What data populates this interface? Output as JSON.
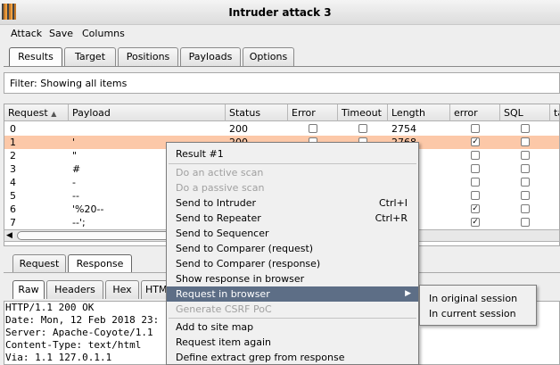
{
  "window": {
    "title": "Intruder attack 3"
  },
  "menubar": [
    "Attack",
    "Save",
    "Columns"
  ],
  "main_tabs": [
    "Results",
    "Target",
    "Positions",
    "Payloads",
    "Options"
  ],
  "filter": {
    "text": "Filter: Showing all items"
  },
  "table": {
    "sort_arrow": "▲",
    "headers": [
      "Request",
      "Payload",
      "Status",
      "Error",
      "Timeout",
      "Length",
      "error",
      "SQL",
      "ta"
    ],
    "rows": [
      {
        "request": "0",
        "payload": "",
        "status": "200",
        "length": "2754",
        "error": false,
        "timeout": false,
        "error_col": false,
        "sql": false
      },
      {
        "request": "1",
        "payload": "'",
        "status": "200",
        "length": "2768",
        "error": false,
        "timeout": false,
        "error_col": true,
        "sql": false
      },
      {
        "request": "2",
        "payload": "\"",
        "status": "",
        "length": "",
        "error": false,
        "timeout": false,
        "error_col": false,
        "sql": false
      },
      {
        "request": "3",
        "payload": "#",
        "status": "",
        "length": "",
        "error": false,
        "timeout": false,
        "error_col": false,
        "sql": false
      },
      {
        "request": "4",
        "payload": "-",
        "status": "",
        "length": "",
        "error": false,
        "timeout": false,
        "error_col": false,
        "sql": false
      },
      {
        "request": "5",
        "payload": "--",
        "status": "",
        "length": "",
        "error": false,
        "timeout": false,
        "error_col": false,
        "sql": false
      },
      {
        "request": "6",
        "payload": "'%20--",
        "status": "",
        "length": "",
        "error": false,
        "timeout": false,
        "error_col": true,
        "sql": false
      },
      {
        "request": "7",
        "payload": "--';",
        "status": "",
        "length": "",
        "error": false,
        "timeout": false,
        "error_col": true,
        "sql": false
      }
    ],
    "check_mark": "✓",
    "scroll_left": "◀"
  },
  "panel_tabs": [
    "Request",
    "Response"
  ],
  "response_tabs": [
    "Raw",
    "Headers",
    "Hex",
    "HTM"
  ],
  "response_lines": [
    "HTTP/1.1 200 OK",
    "Date: Mon, 12 Feb 2018 23:",
    "Server: Apache-Coyote/1.1",
    "Content-Type: text/html",
    "Via: 1.1 127.0.1.1"
  ],
  "context_menu": {
    "items": [
      {
        "label": "Result #1",
        "disabled": false
      },
      {
        "label": "Do an active scan",
        "disabled": true
      },
      {
        "label": "Do a passive scan",
        "disabled": true
      },
      {
        "label": "Send to Intruder",
        "shortcut": "Ctrl+I",
        "disabled": false
      },
      {
        "label": "Send to Repeater",
        "shortcut": "Ctrl+R",
        "disabled": false
      },
      {
        "label": "Send to Sequencer",
        "disabled": false
      },
      {
        "label": "Send to Comparer (request)",
        "disabled": false
      },
      {
        "label": "Send to Comparer (response)",
        "disabled": false
      },
      {
        "label": "Show response in browser",
        "disabled": false
      },
      {
        "label": "Request in browser",
        "disabled": false,
        "highlighted": true,
        "submenu_arrow": "▶"
      },
      {
        "label": "Generate CSRF PoC",
        "disabled": true
      },
      {
        "label": "Add to site map",
        "disabled": false
      },
      {
        "label": "Request item again",
        "disabled": false
      },
      {
        "label": "Define extract grep from response",
        "disabled": false
      }
    ]
  },
  "submenu": {
    "items": [
      "In original session",
      "In current session"
    ]
  },
  "colors": {
    "selected_row": "#fcc8a8",
    "menu_highlight": "#5d6e86"
  }
}
